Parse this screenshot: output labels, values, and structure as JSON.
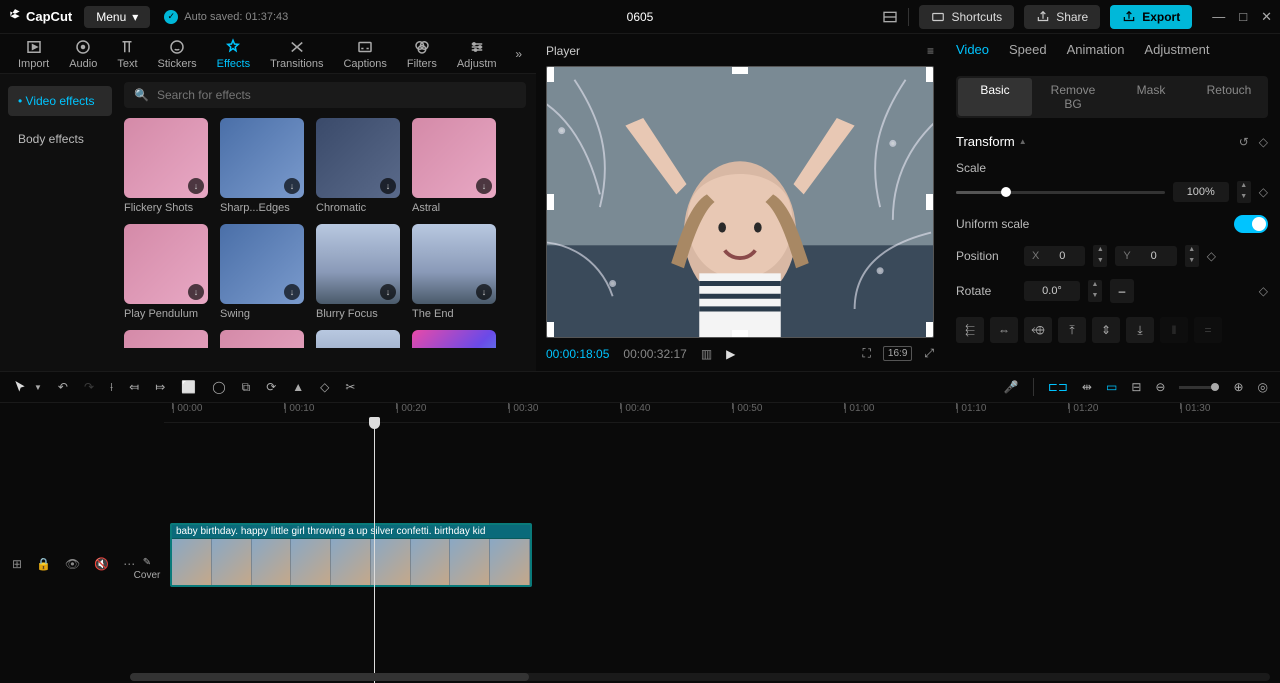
{
  "titlebar": {
    "logo": "CapCut",
    "menu": "Menu",
    "autosave": "Auto saved: 01:37:43",
    "project": "0605",
    "shortcuts": "Shortcuts",
    "share": "Share",
    "export": "Export"
  },
  "toolTabs": [
    "Import",
    "Audio",
    "Text",
    "Stickers",
    "Effects",
    "Transitions",
    "Captions",
    "Filters",
    "Adjustm"
  ],
  "activeToolTab": "Effects",
  "effectsSidebar": {
    "video": "Video effects",
    "body": "Body effects"
  },
  "search": {
    "placeholder": "Search for effects"
  },
  "effects": [
    {
      "label": "Flickery Shots",
      "cls": ""
    },
    {
      "label": "Sharp...Edges",
      "cls": "blue"
    },
    {
      "label": "Chromatic",
      "cls": "dark"
    },
    {
      "label": "Astral",
      "cls": ""
    },
    {
      "label": "Play Pendulum",
      "cls": ""
    },
    {
      "label": "Swing",
      "cls": "blue"
    },
    {
      "label": "Blurry Focus",
      "cls": "city"
    },
    {
      "label": "The End",
      "cls": "city"
    },
    {
      "label": "",
      "cls": ""
    },
    {
      "label": "",
      "cls": ""
    },
    {
      "label": "",
      "cls": "city"
    },
    {
      "label": "",
      "cls": "neon"
    }
  ],
  "player": {
    "title": "Player",
    "current": "00:00:18:05",
    "duration": "00:00:32:17",
    "ratio": "16:9"
  },
  "rightTabs": [
    "Video",
    "Speed",
    "Animation",
    "Adjustment"
  ],
  "subTabs": [
    "Basic",
    "Remove BG",
    "Mask",
    "Retouch"
  ],
  "transform": {
    "title": "Transform",
    "scaleLabel": "Scale",
    "scaleValue": "100%",
    "uniformLabel": "Uniform scale",
    "positionLabel": "Position",
    "posX": "0",
    "posY": "0",
    "rotateLabel": "Rotate",
    "rotateValue": "0.0°"
  },
  "rulerTicks": [
    "00:00",
    "00:10",
    "00:20",
    "00:30",
    "00:40",
    "00:50",
    "01:00",
    "01:10",
    "01:20",
    "01:30"
  ],
  "coverLabel": "Cover",
  "clip": {
    "label": "baby birthday. happy little girl throwing a up silver confetti. birthday kid"
  }
}
